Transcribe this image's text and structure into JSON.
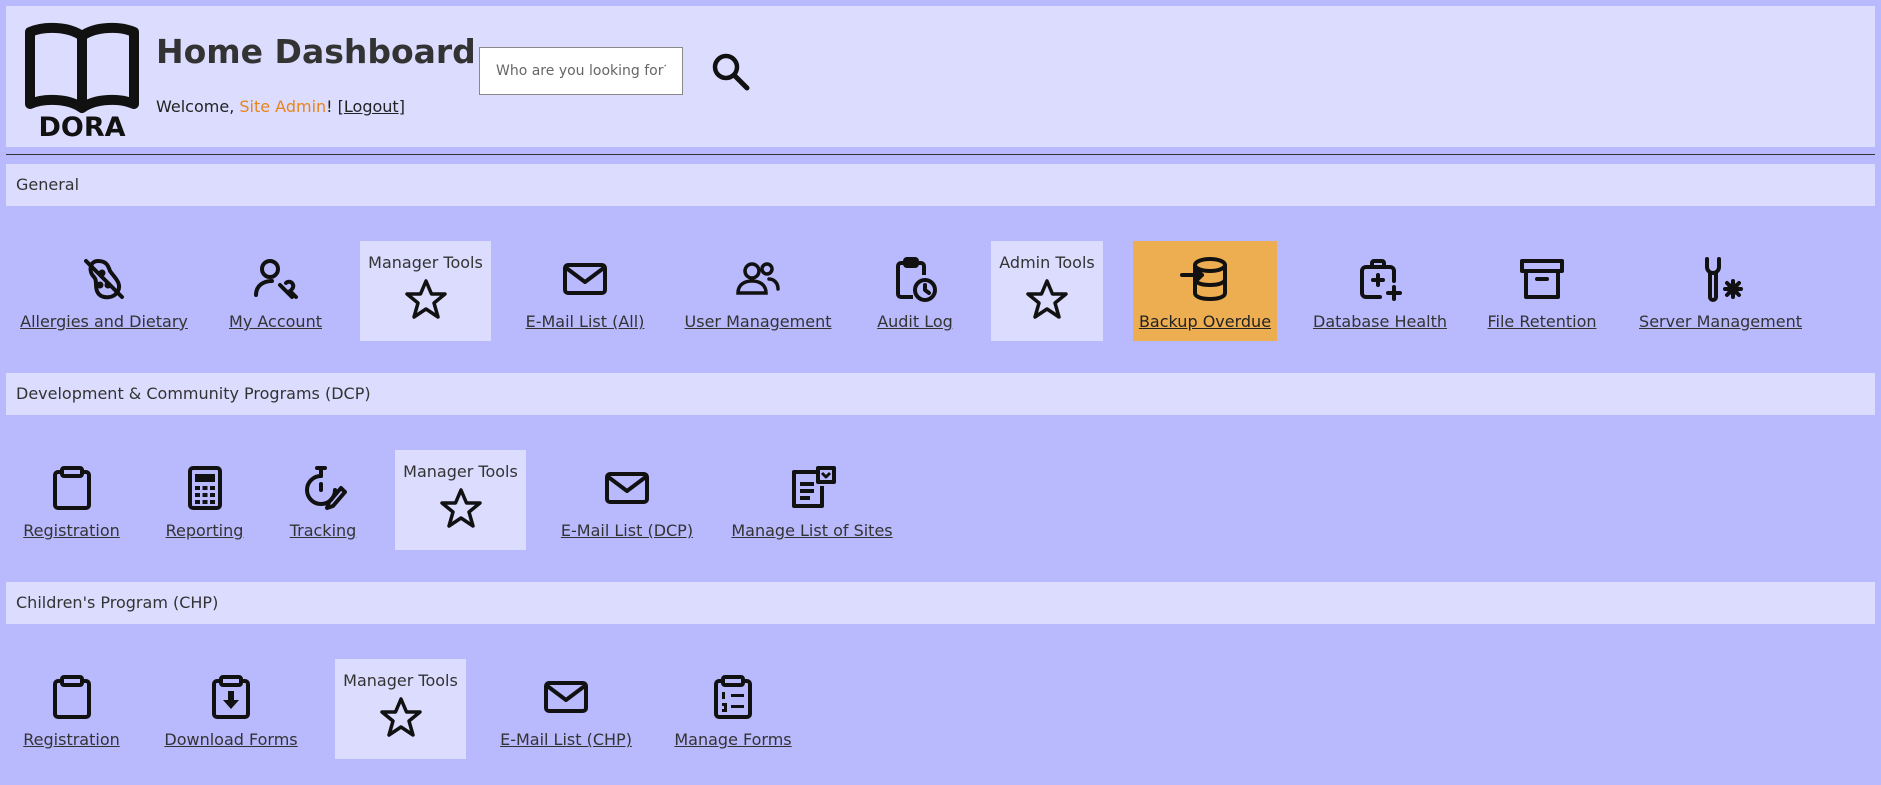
{
  "header": {
    "logo_text": "DORA",
    "title": "Home Dashboard",
    "welcome_prefix": "Welcome, ",
    "user_name": "Site Admin",
    "welcome_mid": "! [",
    "logout_label": "Logout",
    "welcome_suffix": "]",
    "search_placeholder": "Who are you looking for?"
  },
  "sections": {
    "general": {
      "title": "General",
      "items": [
        {
          "label": "Allergies and Dietary",
          "icon": "allergy-icon"
        },
        {
          "label": "My Account",
          "icon": "user-wrench-icon"
        },
        {
          "label": "Manager Tools",
          "icon": "star-icon"
        },
        {
          "label": "E-Mail List (All)",
          "icon": "mail-icon"
        },
        {
          "label": "User Management",
          "icon": "users-icon"
        },
        {
          "label": "Audit Log",
          "icon": "clipboard-clock-icon"
        },
        {
          "label": "Admin Tools",
          "icon": "star-icon"
        },
        {
          "label": "Backup Overdue",
          "icon": "database-import-icon"
        },
        {
          "label": "Database Health",
          "icon": "first-aid-kit-icon"
        },
        {
          "label": "File Retention",
          "icon": "archive-icon"
        },
        {
          "label": "Server Management",
          "icon": "tool-gear-icon"
        }
      ]
    },
    "dcp": {
      "title": "Development & Community Programs (DCP)",
      "items": [
        {
          "label": "Registration",
          "icon": "clipboard-icon"
        },
        {
          "label": "Reporting",
          "icon": "calculator-icon"
        },
        {
          "label": "Tracking",
          "icon": "stopwatch-icon"
        },
        {
          "label": "Manager Tools",
          "icon": "star-icon"
        },
        {
          "label": "E-Mail List (DCP)",
          "icon": "mail-icon"
        },
        {
          "label": "Manage List of Sites",
          "icon": "list-dropdown-icon"
        }
      ]
    },
    "chp": {
      "title": "Children's Program (CHP)",
      "items": [
        {
          "label": "Registration",
          "icon": "clipboard-icon"
        },
        {
          "label": "Download Forms",
          "icon": "clipboard-download-icon"
        },
        {
          "label": "Manager Tools",
          "icon": "star-icon"
        },
        {
          "label": "E-Mail List (CHP)",
          "icon": "mail-icon"
        },
        {
          "label": "Manage Forms",
          "icon": "clipboard-list-icon"
        }
      ]
    }
  },
  "colors": {
    "page_bg": "#b9b9fe",
    "panel_bg": "#dcdcff",
    "warning_bg": "#ecae50",
    "user_accent": "#e8851a"
  }
}
